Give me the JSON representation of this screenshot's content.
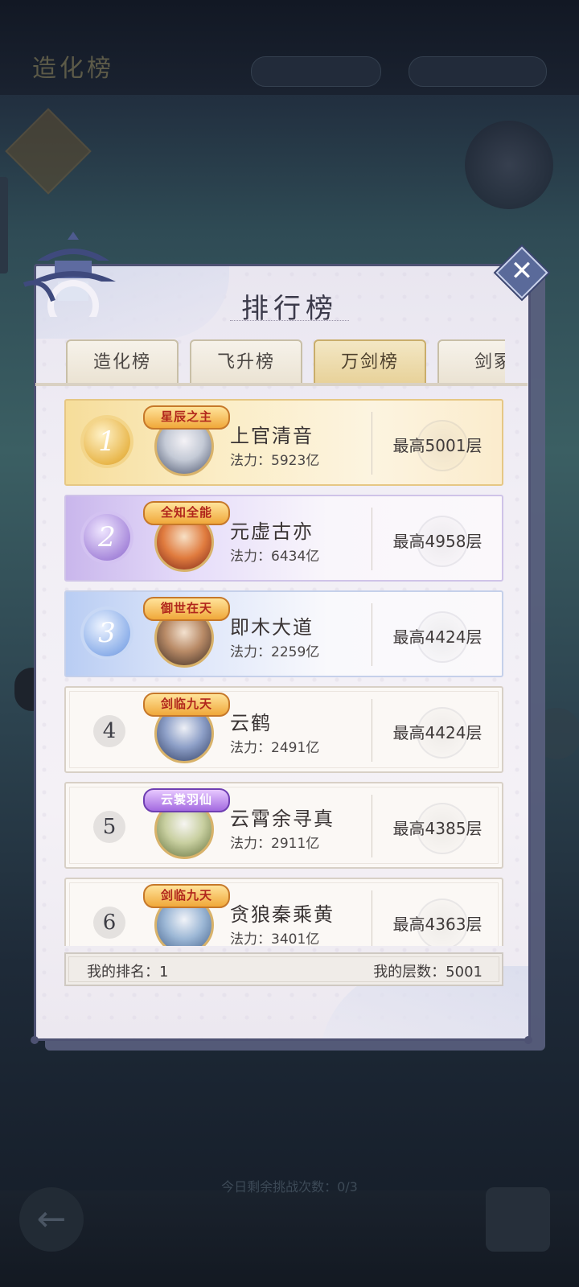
{
  "background": {
    "title": "造化榜",
    "bottom_hint": "今日剩余挑战次数：0/3"
  },
  "panel": {
    "title": "排行榜"
  },
  "tabs": [
    {
      "label": "造化榜",
      "active": false
    },
    {
      "label": "飞升榜",
      "active": false
    },
    {
      "label": "万剑榜",
      "active": true
    },
    {
      "label": "剑冢",
      "active": false
    }
  ],
  "rankings": [
    {
      "rank": "1",
      "badge": "星辰之主",
      "name": "上官清音",
      "power_label": "法力：",
      "power": "5923亿",
      "floor": "最高5001层"
    },
    {
      "rank": "2",
      "badge": "全知全能",
      "name": "元虚古亦",
      "power_label": "法力：",
      "power": "6434亿",
      "floor": "最高4958层"
    },
    {
      "rank": "3",
      "badge": "御世在天",
      "name": "即木大道",
      "power_label": "法力：",
      "power": "2259亿",
      "floor": "最高4424层"
    },
    {
      "rank": "4",
      "badge": "剑临九天",
      "name": "云鹤",
      "power_label": "法力：",
      "power": "2491亿",
      "floor": "最高4424层"
    },
    {
      "rank": "5",
      "badge": "云裳羽仙",
      "name": "云霄余寻真",
      "power_label": "法力：",
      "power": "2911亿",
      "floor": "最高4385层"
    },
    {
      "rank": "6",
      "badge": "剑临九天",
      "name": "贪狼秦乘黄",
      "power_label": "法力：",
      "power": "3401亿",
      "floor": "最高4363层"
    }
  ],
  "footer": {
    "my_rank": "我的排名：1",
    "my_floor": "我的层数：5001"
  },
  "colors": {
    "panel_border": "#4e5273",
    "active_tab": "#e8d29a",
    "rank1": "#e9b84e",
    "rank2": "#a98bdc",
    "rank3": "#8fb1ea"
  }
}
